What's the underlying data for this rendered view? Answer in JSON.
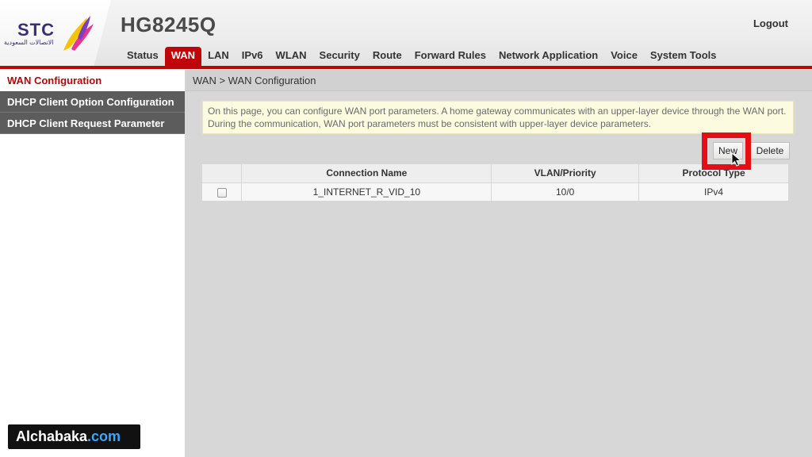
{
  "brand": {
    "logo_text": "STC",
    "logo_subtext": "الاتصالات السعودية",
    "model": "HG8245Q"
  },
  "header": {
    "logout_label": "Logout",
    "nav": [
      {
        "label": "Status",
        "active": false
      },
      {
        "label": "WAN",
        "active": true
      },
      {
        "label": "LAN",
        "active": false
      },
      {
        "label": "IPv6",
        "active": false
      },
      {
        "label": "WLAN",
        "active": false
      },
      {
        "label": "Security",
        "active": false
      },
      {
        "label": "Route",
        "active": false
      },
      {
        "label": "Forward Rules",
        "active": false
      },
      {
        "label": "Network Application",
        "active": false
      },
      {
        "label": "Voice",
        "active": false
      },
      {
        "label": "System Tools",
        "active": false
      }
    ]
  },
  "sidebar": {
    "items": [
      {
        "label": "WAN Configuration",
        "active": true
      },
      {
        "label": "DHCP Client Option Configuration",
        "active": false
      },
      {
        "label": "DHCP Client Request Parameter",
        "active": false
      }
    ]
  },
  "main": {
    "breadcrumb": "WAN > WAN Configuration",
    "info_text": "On this page, you can configure WAN port parameters. A home gateway communicates with an upper-layer device through the WAN port. During the communication, WAN port parameters must be consistent with upper-layer device parameters.",
    "buttons": {
      "new_label": "New",
      "delete_label": "Delete"
    },
    "table": {
      "headers": [
        "",
        "Connection Name",
        "VLAN/Priority",
        "Protocol Type"
      ],
      "rows": [
        {
          "checked": false,
          "connection_name": "1_INTERNET_R_VID_10",
          "vlan_priority": "10/0",
          "protocol_type": "IPv4"
        }
      ]
    }
  },
  "watermark": {
    "main": "Alchabaka",
    "tld": ".com"
  },
  "colors": {
    "accent_red": "#c0050a",
    "highlight_red": "#e50e14",
    "sidebar_dark": "#5c5c5c",
    "info_bg": "#fcfbe0",
    "logo_purple": "#3a2f74"
  }
}
